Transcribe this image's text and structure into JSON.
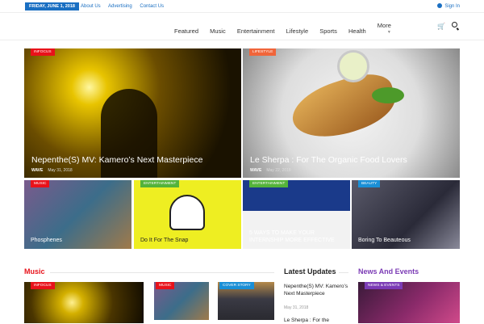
{
  "topbar": {
    "date": "FRIDAY, JUNE 1, 2018",
    "links": [
      "About Us",
      "Advertising",
      "Contact Us"
    ],
    "signin": "Sign In"
  },
  "nav": {
    "items": [
      "Featured",
      "Music",
      "Entertainment",
      "Lifestyle",
      "Sports",
      "Health",
      "More"
    ]
  },
  "hero": [
    {
      "tag": "INFOCUS",
      "tag_color": "#e8121a",
      "title": "Nepenthe(S) MV: Kamero’s Next Masterpiece",
      "author": "WAVE",
      "date": "May 31, 2018"
    },
    {
      "tag": "LIFESTYLE",
      "tag_color": "#f0653a",
      "title": "Le Sherpa : For The Organic Food Lovers",
      "author": "WAVE",
      "date": "May 22, 2018"
    }
  ],
  "grid": [
    {
      "tag": "MUSIC",
      "tag_color": "#e8121a",
      "title": "Phosphenes"
    },
    {
      "tag": "ENTERTAINMENT",
      "tag_color": "#54b33a",
      "title": "Do It For The Snap"
    },
    {
      "tag": "ENTERTAINMENT",
      "tag_color": "#54b33a",
      "title": "5 WAYS TO MAKE YOUR INTERNSHIP MORE EFFECTIVE"
    },
    {
      "tag": "BEAUTY",
      "tag_color": "#1a8fd6",
      "title": "Boring To Beauteous"
    }
  ],
  "sections": {
    "music": "Music",
    "updates": "Latest Updates",
    "news": "News And Events"
  },
  "bottom_tags": {
    "music_main": "INFOCUS",
    "music_small1": "MUSIC",
    "music_small2": "COVER STORY",
    "news": "NEWS & EVENTS"
  },
  "updates": [
    {
      "title": "Nepenthe(S) MV: Kamero’s Next Masterpiece",
      "date": "May 31, 2018"
    },
    {
      "title": "Le Sherpa : For the",
      "date": ""
    }
  ]
}
